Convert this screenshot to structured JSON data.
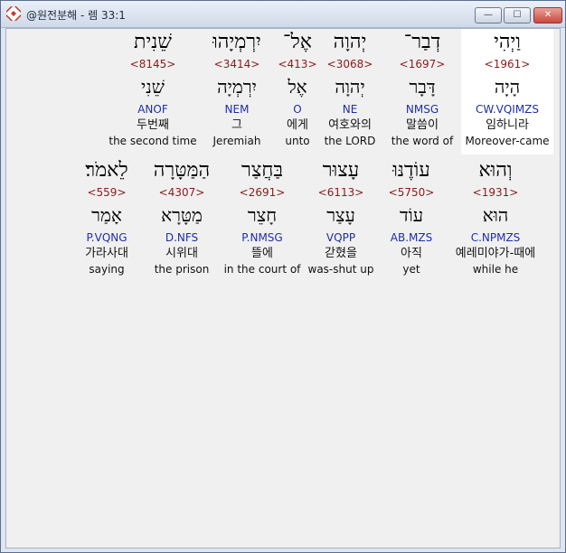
{
  "window": {
    "title": "@원전분해 - 렘 33:1",
    "buttons": {
      "min": "—",
      "max": "☐",
      "close": "✕"
    }
  },
  "rows": [
    [
      {
        "heb": "וַיְהִי",
        "num": "<1961>",
        "root": "הָיָה",
        "parse": "CW.VQIMZS",
        "kor": "임하니라",
        "eng": "Moreover-came",
        "highlight": true
      },
      {
        "heb": "דְבַר־",
        "num": "<1697>",
        "root": "דָּבָר",
        "parse": "NMSG",
        "kor": "말씀이",
        "eng": "the word of"
      },
      {
        "heb": "יְהוָה",
        "num": "<3068>",
        "root": "יְהוָה",
        "parse": "NE",
        "kor": "여호와의",
        "eng": "the LORD"
      },
      {
        "heb": "אֶל־",
        "num": "<413>",
        "root": "אֶל",
        "parse": "O",
        "kor": "에게",
        "eng": "unto"
      },
      {
        "heb": "יִרְמְיָהוּ",
        "num": "<3414>",
        "root": "יִרְמְיָה",
        "parse": "NEM",
        "kor": "그",
        "eng": "Jeremiah"
      },
      {
        "heb": "שֵׁנִית",
        "num": "<8145>",
        "root": "שֵׁנִי",
        "parse": "ANOF",
        "kor": "두번째",
        "eng": "the second time"
      }
    ],
    [
      {
        "heb": "וְהוּא",
        "num": "<1931>",
        "root": "הוּא",
        "parse": "C.NPMZS",
        "kor": "예레미야가-때에",
        "eng": "while he"
      },
      {
        "heb": "עוֹדֶנּוּ",
        "num": "<5750>",
        "root": "עוֹד",
        "parse": "AB.MZS",
        "kor": "아직",
        "eng": "yet"
      },
      {
        "heb": "עָצוּר",
        "num": "<6113>",
        "root": "עָצַר",
        "parse": "VQPP",
        "kor": "갇혔을",
        "eng": "was-shut up"
      },
      {
        "heb": "בַּחֲצַר",
        "num": "<2691>",
        "root": "חָצֵר",
        "parse": "P.NMSG",
        "kor": "뜰에",
        "eng": "in the court of"
      },
      {
        "heb": "הַמַּטָּרָה",
        "num": "<4307>",
        "root": "מַטָּרָא",
        "parse": "D.NFS",
        "kor": "시위대",
        "eng": "the prison"
      },
      {
        "heb": "לֵאמֹר׃",
        "num": "<559>",
        "root": "אָמַר",
        "parse": "P.VQNG",
        "kor": "가라사대",
        "eng": "saying"
      }
    ]
  ]
}
